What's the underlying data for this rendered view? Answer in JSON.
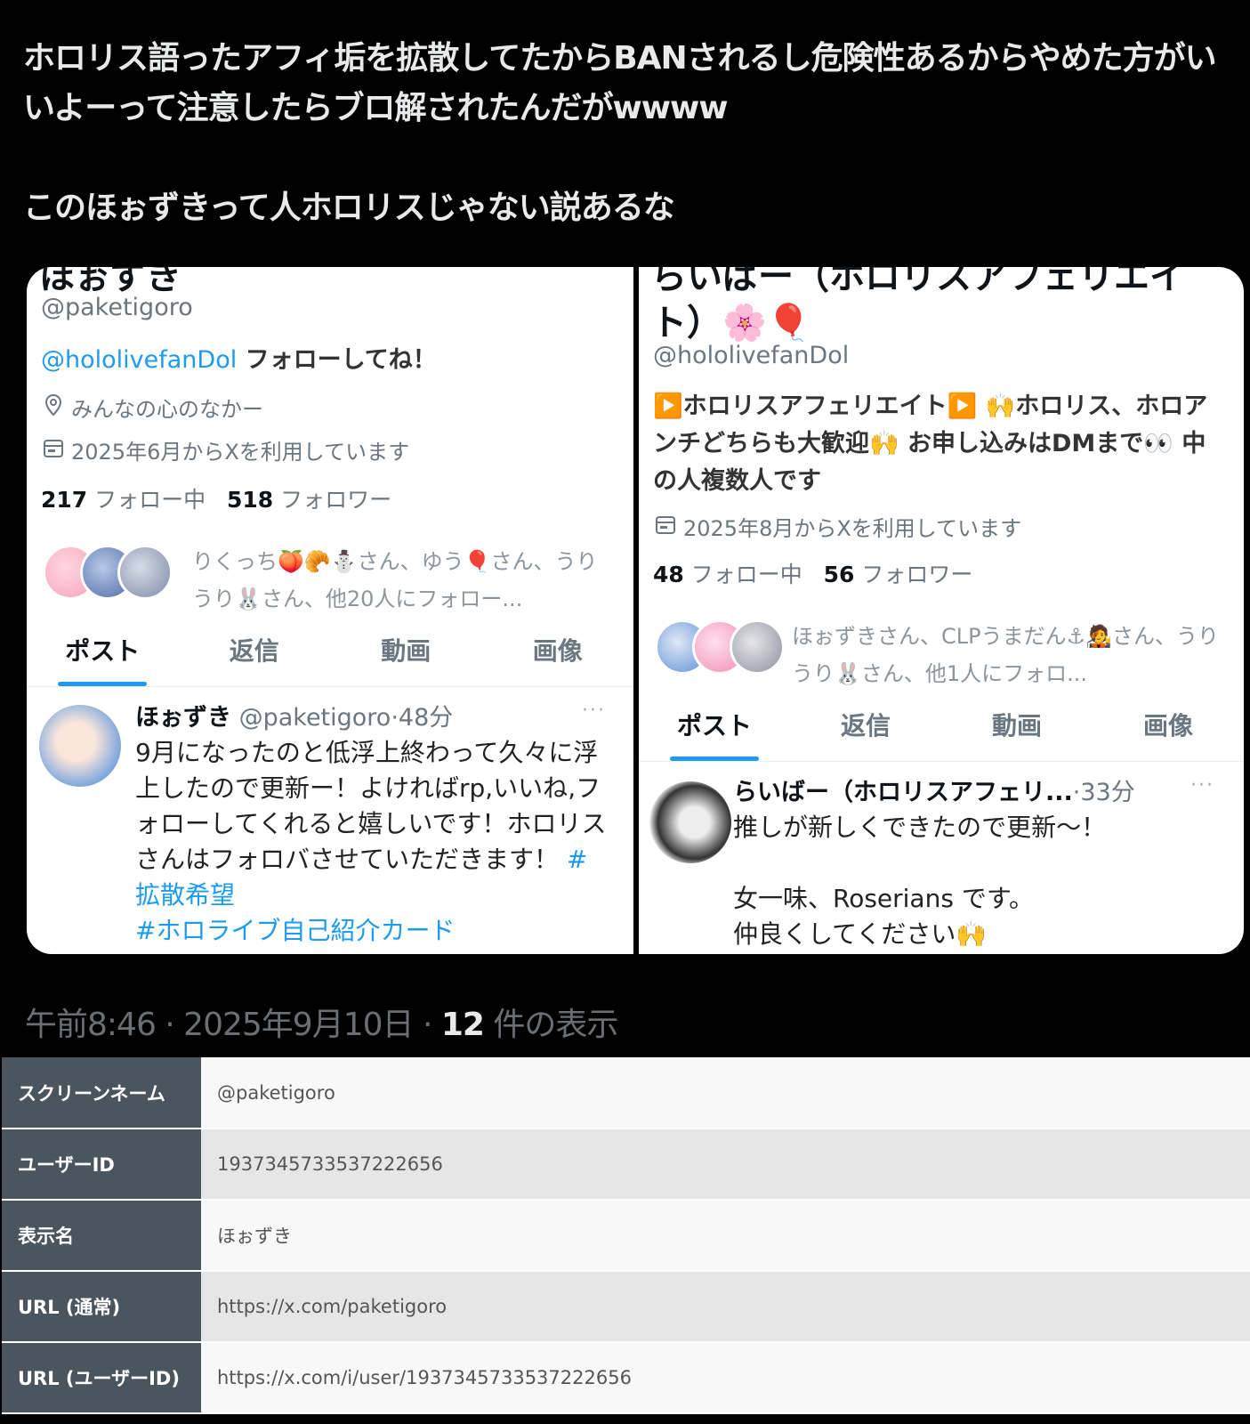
{
  "tweet": {
    "text_line1": "ホロリス語ったアフィ垢を拡散してたからBANされるし危険性あるからやめた方がいいよーって注意したらブロ解されたんだがwwww",
    "text_line2": "このほぉずきって人ホロリスじゃない説あるな",
    "time": "午前8:46 · 2025年9月10日 · ",
    "views_count": "12",
    "views_label": " 件の表示"
  },
  "left_profile": {
    "name_cut": "ほぉずき",
    "handle": "@paketigoro",
    "bio_link": "@hololivefanDol",
    "bio_rest": " フォローしてね！",
    "location": "みんなの心のなかー",
    "joined": "2025年6月からXを利用しています",
    "following_count": "217",
    "following_label": " フォロー中",
    "followers_count": "518",
    "followers_label": " フォロワー",
    "followed_by": "りくっち🍑🥐⛄さん、ゆう🎈さん、うりうり🐰さん、他20人にフォロー...",
    "tabs": [
      "ポスト",
      "返信",
      "動画",
      "画像"
    ],
    "post": {
      "name": "ほぉずき",
      "handle_time": " @paketigoro·48分",
      "body": "9月になったのと低浮上終わって久々に浮上したので更新ー！よければrp,いいね,フォローしてくれると嬉しいです！ホロリスさんはフォロバさせていただきます！ ",
      "tag1": "#拡散希望",
      "tag2": "#ホロライブ自己紹介カード",
      "more": "···"
    }
  },
  "right_profile": {
    "name_cut": "らいばー（ホロリスアフェリエイ",
    "name_line2": "ト）🌸🎈",
    "handle": "@hololivefanDol",
    "bio": "▶️ホロリスアフェリエイト▶️ 🙌ホロリス、ホロアンチどちらも大歓迎🙌 お申し込みはDMまで👀 中の人複数人です",
    "joined": "2025年8月からXを利用しています",
    "following_count": "48",
    "following_label": " フォロー中",
    "followers_count": "56",
    "followers_label": " フォロワー",
    "followed_by": "ほぉずきさん、CLPうまだん⚓🧑‍🎤さん、うりうり🐰さん、他1人にフォロ...",
    "tabs": [
      "ポスト",
      "返信",
      "動画",
      "画像"
    ],
    "post": {
      "name": "らいばー（ホロリスアフェリ...",
      "time": "·33分",
      "line1": "推しが新しくできたので更新〜！",
      "line2": "女一味、Roserians です。",
      "line3": "仲良くしてください🙌",
      "more": "···"
    }
  },
  "info_table": [
    {
      "label": "スクリーンネーム",
      "value": "@paketigoro"
    },
    {
      "label": "ユーザーID",
      "value": "1937345733537222656"
    },
    {
      "label": "表示名",
      "value": "ほぉずき"
    },
    {
      "label": "URL (通常)",
      "value": "https://x.com/paketigoro"
    },
    {
      "label": "URL (ユーザーID)",
      "value": "https://x.com/i/user/1937345733537222656"
    }
  ],
  "colors": {
    "link": "#1d9bf0",
    "table_header": "#4b555e"
  },
  "icons": [
    "location-pin-icon",
    "calendar-icon",
    "more-icon"
  ]
}
